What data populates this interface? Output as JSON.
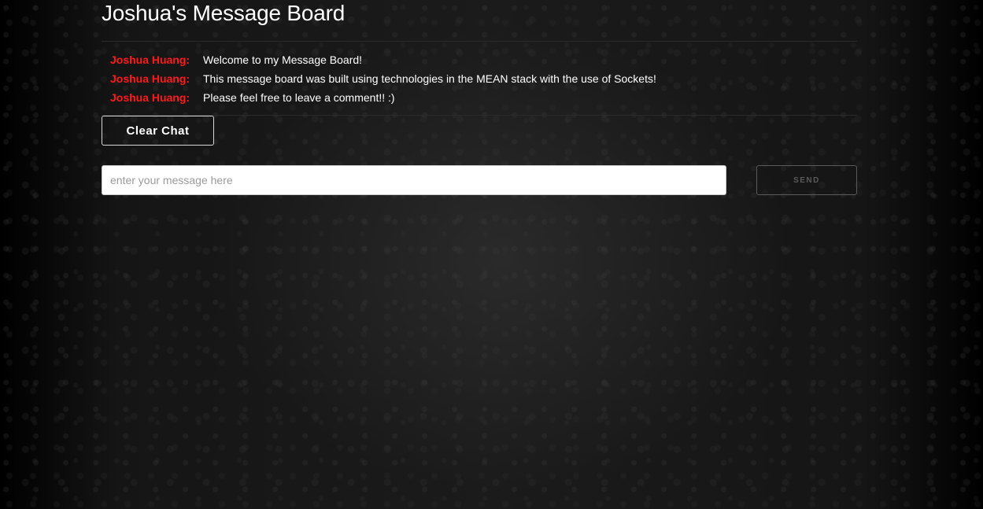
{
  "page": {
    "title": "Joshua's Message Board"
  },
  "messages": [
    {
      "author": "Joshua Huang:",
      "text": "Welcome to my Message Board!"
    },
    {
      "author": "Joshua Huang:",
      "text": "This message board was built using technologies in the MEAN stack with the use of Sockets!"
    },
    {
      "author": "Joshua Huang:",
      "text": "Please feel free to leave a comment!! :)"
    }
  ],
  "controls": {
    "clear_label": "Clear Chat",
    "input_placeholder": "enter your message here",
    "input_value": "",
    "send_label": "SEND"
  },
  "colors": {
    "background": "#141414",
    "author": "#ff1a1a",
    "text": "#ffffff"
  }
}
